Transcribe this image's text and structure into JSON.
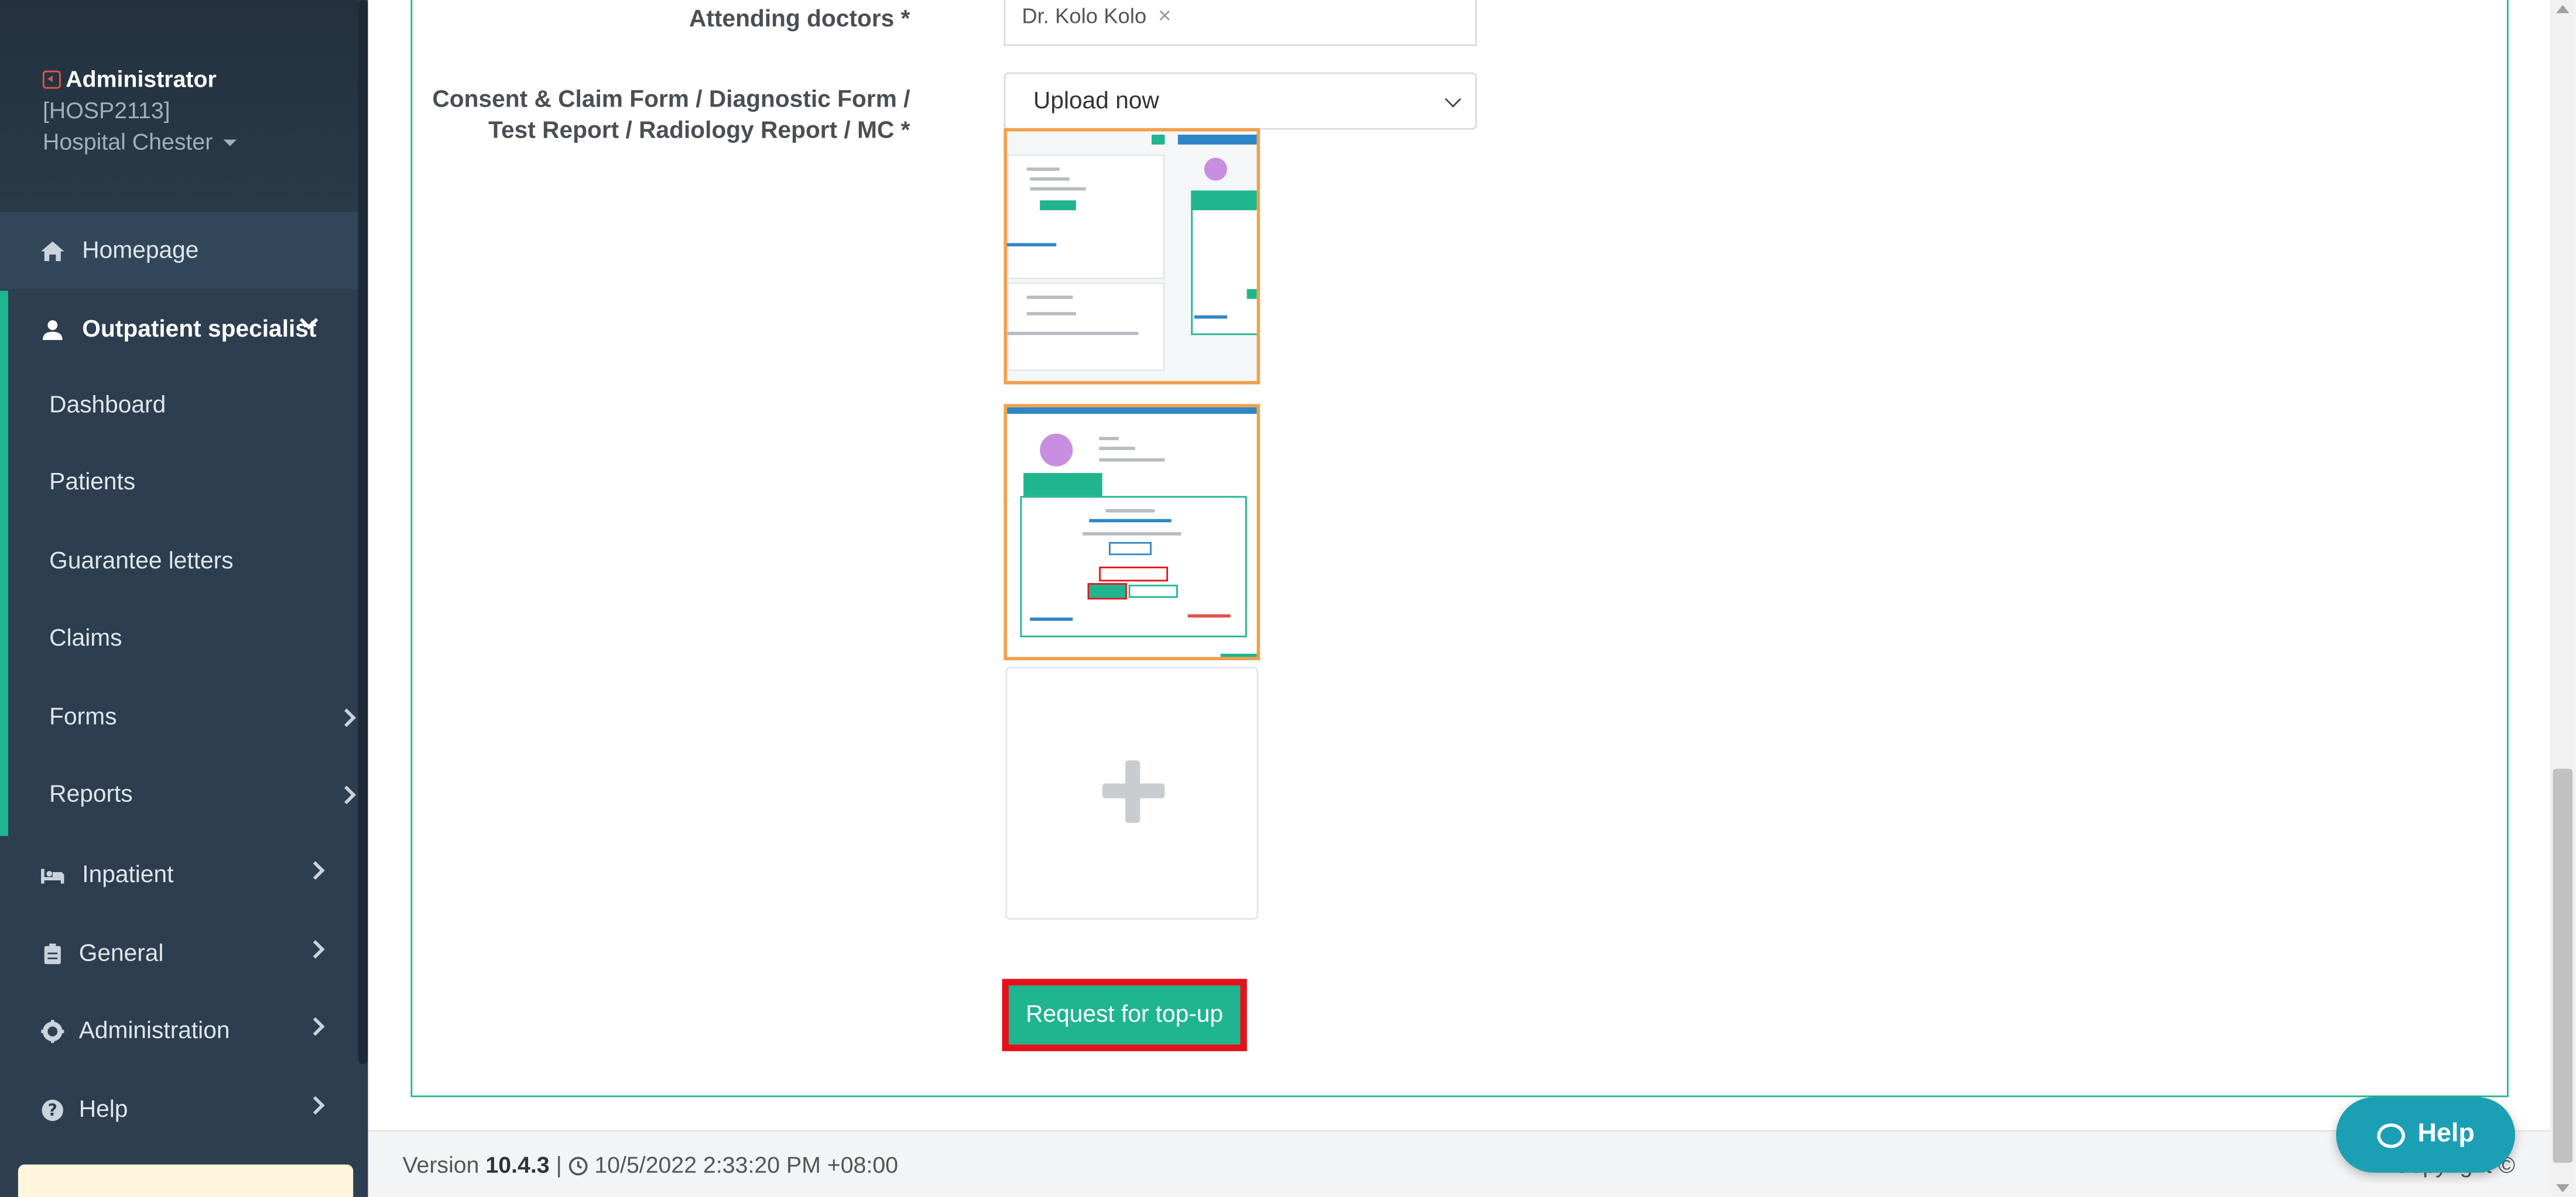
{
  "sidebar": {
    "profile": {
      "name": "Administrator",
      "code": "[HOSP2113]",
      "hospital": "Hospital Chester"
    },
    "nav": {
      "homepage": "Homepage",
      "outpatient": "Outpatient specialist",
      "dashboard": "Dashboard",
      "patients": "Patients",
      "guarantee_letters": "Guarantee letters",
      "claims": "Claims",
      "forms": "Forms",
      "reports": "Reports",
      "inpatient": "Inpatient",
      "general": "General",
      "administration": "Administration",
      "help": "Help"
    }
  },
  "form": {
    "attending_label": "Attending doctors *",
    "attending_tag": "Dr. Kolo Kolo",
    "tag_remove": "×",
    "docs_label_line1": "Consent & Claim Form / Diagnostic Form /",
    "docs_label_line2": "Test Report / Radiology Report / MC *",
    "upload_select": "Upload now",
    "submit_button": "Request for top-up"
  },
  "footer": {
    "version_prefix": "Version",
    "version": "10.4.3",
    "separator": "|",
    "timestamp": "10/5/2022 2:33:20 PM +08:00",
    "copyright": "Copyright ©"
  },
  "help_widget": {
    "label": "Help"
  },
  "colors": {
    "sidebar_bg": "#2c3e4f",
    "accent_green": "#1fb58f",
    "highlight_red": "#e8101a",
    "thumb_border": "#f0a04b",
    "help_blue": "#1b9fb4"
  }
}
